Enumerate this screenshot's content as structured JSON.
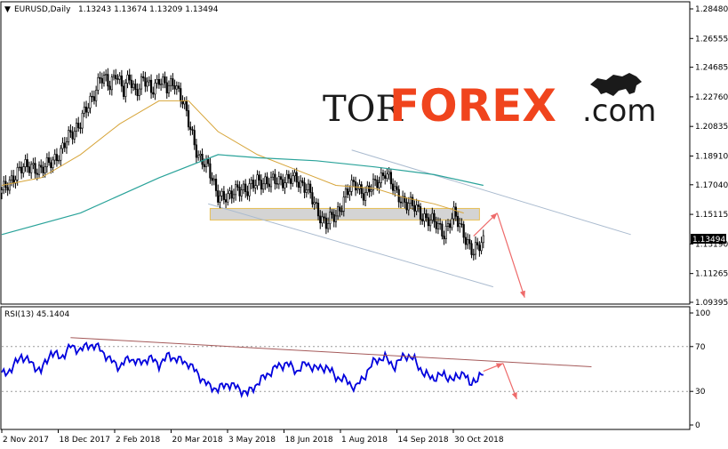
{
  "header": {
    "symbol": "EURUSD,Daily",
    "ohlc": "1.13243 1.13674 1.13209 1.13494"
  },
  "logo": {
    "part1": "TOR",
    "part2": "FOREX",
    "part3": ".com",
    "icon": "bull-bear-icon"
  },
  "colors": {
    "candle": "#000000",
    "ma_short": "#d7a53a",
    "ma_long": "#2aa39a",
    "channel": "#aabbcf",
    "zone_fill": "#d4d4d4",
    "zone_border": "#e7bf55",
    "forecast_arrow": "#ee6a6a",
    "rsi_line": "#0000dd",
    "rsi_trend": "#a55a5a",
    "brand_orange": "#f0441d"
  },
  "price_axis": {
    "ticks": [
      "1.28480",
      "1.26555",
      "1.24685",
      "1.22760",
      "1.20835",
      "1.18910",
      "1.17040",
      "1.15115",
      "1.13190",
      "1.11265",
      "1.09395"
    ],
    "current": "1.13494"
  },
  "rsi": {
    "label": "RSI(13) 45.1404",
    "ticks": [
      "100",
      "70",
      "30",
      "0"
    ]
  },
  "time_axis": {
    "labels": [
      "2 Nov 2017",
      "18 Dec 2017",
      "2 Feb 2018",
      "20 Mar 2018",
      "3 May 2018",
      "18 Jun 2018",
      "1 Aug 2018",
      "14 Sep 2018",
      "30 Oct 2018"
    ]
  },
  "chart_data": {
    "type": "candlestick",
    "symbol": "EURUSD",
    "timeframe": "Daily",
    "ylim": [
      1.09395,
      1.2848
    ],
    "x_labels": [
      "2 Nov 2017",
      "18 Dec 2017",
      "2 Feb 2018",
      "20 Mar 2018",
      "3 May 2018",
      "18 Jun 2018",
      "1 Aug 2018",
      "14 Sep 2018",
      "30 Oct 2018"
    ],
    "price_path": [
      [
        0,
        1.165
      ],
      [
        5,
        1.175
      ],
      [
        10,
        1.18
      ],
      [
        15,
        1.184
      ],
      [
        20,
        1.178
      ],
      [
        25,
        1.187
      ],
      [
        30,
        1.19
      ],
      [
        35,
        1.205
      ],
      [
        40,
        1.21
      ],
      [
        45,
        1.225
      ],
      [
        50,
        1.24
      ],
      [
        55,
        1.235
      ],
      [
        58,
        1.245
      ],
      [
        62,
        1.23
      ],
      [
        65,
        1.24
      ],
      [
        68,
        1.232
      ],
      [
        72,
        1.238
      ],
      [
        76,
        1.232
      ],
      [
        80,
        1.24
      ],
      [
        84,
        1.232
      ],
      [
        88,
        1.238
      ],
      [
        92,
        1.225
      ],
      [
        95,
        1.21
      ],
      [
        100,
        1.19
      ],
      [
        105,
        1.18
      ],
      [
        110,
        1.165
      ],
      [
        115,
        1.16
      ],
      [
        120,
        1.17
      ],
      [
        125,
        1.165
      ],
      [
        130,
        1.175
      ],
      [
        135,
        1.17
      ],
      [
        140,
        1.175
      ],
      [
        145,
        1.172
      ],
      [
        150,
        1.175
      ],
      [
        155,
        1.168
      ],
      [
        160,
        1.155
      ],
      [
        165,
        1.145
      ],
      [
        170,
        1.15
      ],
      [
        175,
        1.165
      ],
      [
        180,
        1.17
      ],
      [
        185,
        1.165
      ],
      [
        190,
        1.17
      ],
      [
        195,
        1.18
      ],
      [
        200,
        1.165
      ],
      [
        205,
        1.16
      ],
      [
        210,
        1.155
      ],
      [
        215,
        1.15
      ],
      [
        220,
        1.145
      ],
      [
        225,
        1.14
      ],
      [
        230,
        1.15
      ],
      [
        235,
        1.14
      ],
      [
        238,
        1.13
      ],
      [
        240,
        1.125
      ],
      [
        245,
        1.135
      ]
    ],
    "ma_short": [
      [
        0,
        1.17
      ],
      [
        20,
        1.175
      ],
      [
        40,
        1.19
      ],
      [
        60,
        1.21
      ],
      [
        80,
        1.225
      ],
      [
        95,
        1.225
      ],
      [
        110,
        1.205
      ],
      [
        130,
        1.19
      ],
      [
        150,
        1.18
      ],
      [
        170,
        1.17
      ],
      [
        190,
        1.168
      ],
      [
        205,
        1.162
      ],
      [
        220,
        1.158
      ],
      [
        235,
        1.152
      ]
    ],
    "ma_long": [
      [
        0,
        1.138
      ],
      [
        40,
        1.152
      ],
      [
        80,
        1.175
      ],
      [
        110,
        1.19
      ],
      [
        130,
        1.188
      ],
      [
        160,
        1.186
      ],
      [
        190,
        1.182
      ],
      [
        220,
        1.177
      ],
      [
        245,
        1.17
      ]
    ],
    "channel_upper": [
      [
        178,
        1.193
      ],
      [
        320,
        1.138
      ]
    ],
    "channel_lower": [
      [
        105,
        1.158
      ],
      [
        250,
        1.104
      ]
    ],
    "resistance_zone": [
      1.1475,
      1.155
    ],
    "forecast_path": [
      [
        240,
        1.137
      ],
      [
        252,
        1.152
      ],
      [
        266,
        1.097
      ]
    ],
    "rsi_series": [
      [
        0,
        45
      ],
      [
        5,
        50
      ],
      [
        10,
        62
      ],
      [
        15,
        55
      ],
      [
        20,
        48
      ],
      [
        25,
        65
      ],
      [
        30,
        60
      ],
      [
        35,
        70
      ],
      [
        40,
        67
      ],
      [
        45,
        72
      ],
      [
        50,
        68
      ],
      [
        55,
        58
      ],
      [
        60,
        52
      ],
      [
        65,
        60
      ],
      [
        70,
        55
      ],
      [
        75,
        60
      ],
      [
        80,
        54
      ],
      [
        85,
        62
      ],
      [
        90,
        58
      ],
      [
        95,
        55
      ],
      [
        100,
        45
      ],
      [
        105,
        35
      ],
      [
        110,
        32
      ],
      [
        115,
        37
      ],
      [
        120,
        33
      ],
      [
        125,
        28
      ],
      [
        130,
        37
      ],
      [
        135,
        45
      ],
      [
        140,
        52
      ],
      [
        145,
        55
      ],
      [
        150,
        48
      ],
      [
        155,
        55
      ],
      [
        160,
        50
      ],
      [
        165,
        52
      ],
      [
        170,
        43
      ],
      [
        175,
        40
      ],
      [
        180,
        33
      ],
      [
        185,
        45
      ],
      [
        190,
        58
      ],
      [
        195,
        60
      ],
      [
        200,
        52
      ],
      [
        205,
        63
      ],
      [
        210,
        58
      ],
      [
        215,
        45
      ],
      [
        220,
        42
      ],
      [
        225,
        45
      ],
      [
        230,
        40
      ],
      [
        235,
        48
      ],
      [
        238,
        35
      ],
      [
        240,
        40
      ],
      [
        245,
        45
      ]
    ],
    "rsi_trend": [
      [
        35,
        78
      ],
      [
        300,
        52
      ]
    ],
    "rsi_forecast": [
      [
        245,
        48
      ],
      [
        255,
        55
      ],
      [
        262,
        23
      ]
    ],
    "rsi_ylim": [
      0,
      100
    ],
    "rsi_levels": [
      70,
      30
    ]
  }
}
